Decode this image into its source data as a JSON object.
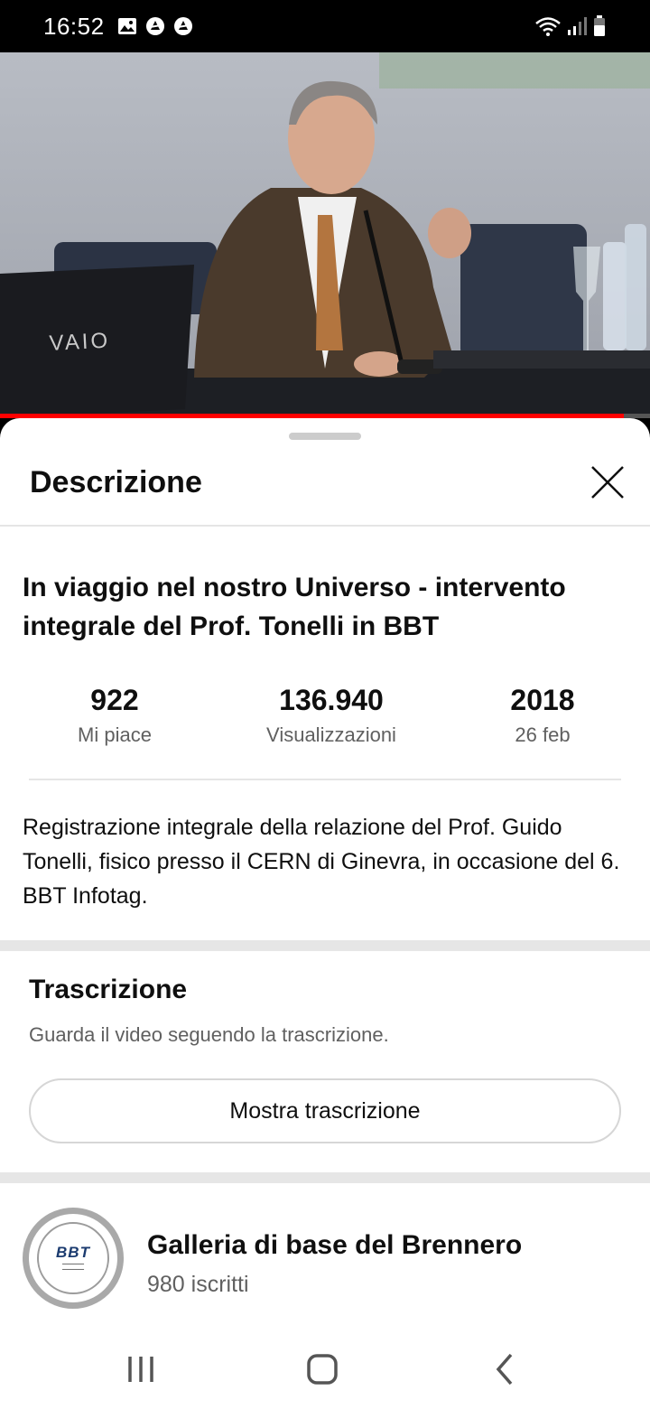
{
  "status_bar": {
    "time": "16:52",
    "icons": [
      "gallery-icon",
      "app-icon",
      "app-icon",
      "wifi-icon",
      "signal-icon",
      "battery-icon"
    ]
  },
  "video": {
    "progress": 0.96,
    "progress_color": "#ff0000"
  },
  "description_panel": {
    "title": "Descrizione",
    "close_icon": "close-icon",
    "video_title": "In viaggio nel nostro Universo - intervento integrale del Prof. Tonelli in BBT",
    "stats": [
      {
        "value": "922",
        "label": "Mi piace"
      },
      {
        "value": "136.940",
        "label": "Visualizzazioni"
      },
      {
        "value": "2018",
        "label": "26 feb"
      }
    ],
    "description": "Registrazione integrale della relazione del Prof. Guido Tonelli, fisico presso il CERN di Ginevra, in occasione del 6. BBT Infotag."
  },
  "transcript": {
    "title": "Trascrizione",
    "subtitle": "Guarda il video seguendo la trascrizione.",
    "button_label": "Mostra trascrizione"
  },
  "channel": {
    "name": "Galleria di base del Brennero",
    "subscribers": "980 iscritti",
    "avatar_logo": "BBT"
  },
  "nav_bar": {
    "buttons": [
      "recent-apps-icon",
      "home-icon",
      "back-icon"
    ]
  },
  "colors": {
    "accent": "#ff0000",
    "secondary_text": "#606060",
    "divider": "#e5e5e5"
  }
}
